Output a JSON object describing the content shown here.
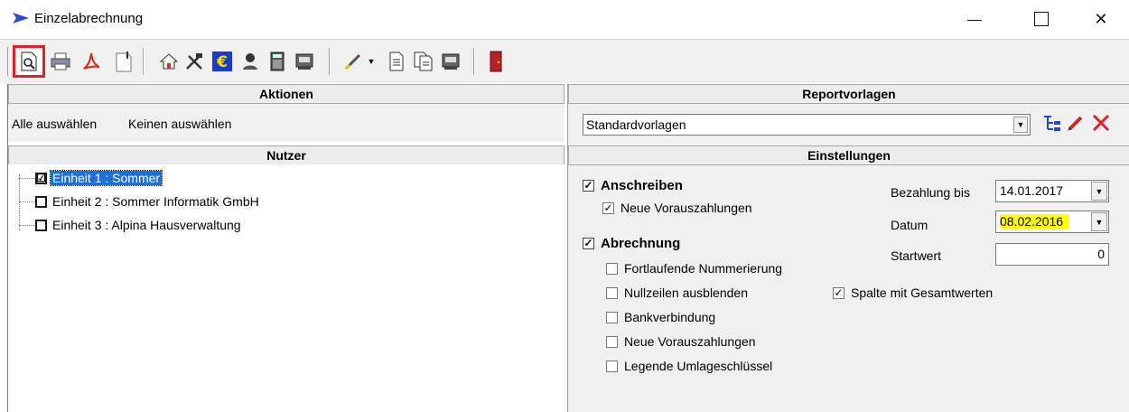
{
  "window": {
    "title": "Einzelabrechnung",
    "controls": {
      "minimize": "minimize-icon",
      "maximize": "maximize-icon",
      "close": "✕"
    }
  },
  "toolbar": {
    "buttons": [
      {
        "icon": "print-preview-icon"
      },
      {
        "icon": "printer-icon"
      },
      {
        "icon": "pdf-icon"
      },
      {
        "icon": "page-icon"
      },
      {
        "icon": "home-icon"
      },
      {
        "icon": "tools-icon"
      },
      {
        "icon": "euro-icon"
      },
      {
        "icon": "person-icon"
      },
      {
        "icon": "calculator-icon"
      },
      {
        "icon": "register-icon"
      },
      {
        "icon": "pen-icon"
      },
      {
        "icon": "document-icon"
      },
      {
        "icon": "copy-documents-icon"
      },
      {
        "icon": "register2-icon"
      },
      {
        "icon": "exit-door-icon"
      }
    ]
  },
  "left": {
    "actions_header": "Aktionen",
    "select_all": "Alle auswählen",
    "select_none": "Keinen auswählen",
    "users_header": "Nutzer",
    "units": [
      {
        "label": "Einheit 1 : Sommer",
        "checked": "☑",
        "selected": true
      },
      {
        "label": "Einheit 2 : Sommer Informatik GmbH",
        "checked": "",
        "selected": false
      },
      {
        "label": "Einheit 3 : Alpina Hausverwaltung",
        "checked": "",
        "selected": false
      }
    ]
  },
  "right": {
    "templates_header": "Reportvorlagen",
    "template_value": "Standardvorlagen",
    "settings_header": "Einstellungen",
    "options": {
      "anschreiben": {
        "label": "Anschreiben",
        "check": "✓"
      },
      "neue_vorauszahlungen_1": {
        "label": "Neue Vorauszahlungen",
        "check": "✓"
      },
      "abrechnung": {
        "label": "Abrechnung",
        "check": "✓"
      },
      "fortlaufende": {
        "label": "Fortlaufende Nummerierung",
        "check": ""
      },
      "nullzeilen": {
        "label": "Nullzeilen ausblenden",
        "check": ""
      },
      "bankverbindung": {
        "label": "Bankverbindung",
        "check": ""
      },
      "neue_vorauszahlungen_2": {
        "label": "Neue Vorauszahlungen",
        "check": ""
      },
      "legende": {
        "label": "Legende Umlageschlüssel",
        "check": ""
      },
      "spalte_gesamt": {
        "label": "Spalte mit Gesamtwerten",
        "check": "✓"
      }
    },
    "fields": {
      "bezahlung_label": "Bezahlung bis",
      "bezahlung_value": "14.01.2017",
      "datum_label": "Datum",
      "datum_value": "08.02.2016",
      "startwert_label": "Startwert",
      "startwert_value": "0"
    },
    "colors": {
      "highlight": "#ffff00"
    }
  }
}
